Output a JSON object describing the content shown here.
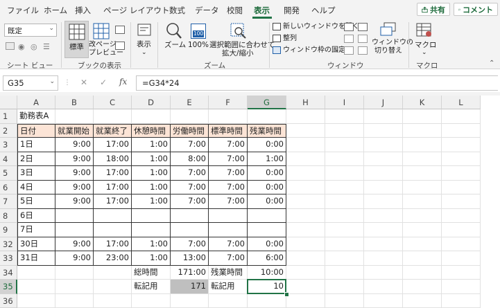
{
  "menu": {
    "tabs": [
      "ファイル",
      "ホーム",
      "挿入",
      "ページ レイアウト",
      "数式",
      "データ",
      "校閲",
      "表示",
      "開発",
      "ヘルプ"
    ],
    "active_tab": "表示",
    "share_label": "共有",
    "comment_label": "コメント"
  },
  "ribbon": {
    "sheet_view": {
      "dropdown_value": "既定",
      "group_label": "シート ビュー"
    },
    "workbook_views": {
      "normal_label": "標準",
      "page_break_label_1": "改ページ",
      "page_break_label_2": "プレビュー",
      "group_label": "ブックの表示"
    },
    "show": {
      "label": "表示"
    },
    "zoom": {
      "zoom_label": "ズーム",
      "hundred_label": "100%",
      "hundred_icon_text": "100",
      "fit_label_1": "選択範囲に合わせて",
      "fit_label_2": "拡大/縮小",
      "group_label": "ズーム"
    },
    "window": {
      "new_window": "新しいウィンドウを開く",
      "arrange": "整列",
      "freeze": "ウィンドウ枠の固定",
      "switch_label_1": "ウィンドウの",
      "switch_label_2": "切り替え",
      "group_label": "ウィンドウ"
    },
    "macro": {
      "label": "マクロ",
      "group_label": "マクロ"
    }
  },
  "formula_bar": {
    "name_box": "G35",
    "fx": "fx",
    "formula": "=G34*24"
  },
  "sheet": {
    "columns": [
      "A",
      "B",
      "C",
      "D",
      "E",
      "F",
      "G",
      "H",
      "I",
      "J",
      "K",
      "L"
    ],
    "selected_column": "G",
    "selected_row": "35",
    "rows": [
      {
        "num": "1",
        "cells": [
          "勤務表A",
          "",
          "",
          "",
          "",
          "",
          ""
        ]
      },
      {
        "num": "2",
        "cells": [
          "日付",
          "就業開始",
          "就業終了",
          "休憩時間",
          "労働時間",
          "標準時間",
          "残業時間"
        ]
      },
      {
        "num": "3",
        "cells": [
          "1日",
          "9:00",
          "17:00",
          "1:00",
          "7:00",
          "7:00",
          "0:00"
        ]
      },
      {
        "num": "4",
        "cells": [
          "2日",
          "9:00",
          "18:00",
          "1:00",
          "8:00",
          "7:00",
          "1:00"
        ]
      },
      {
        "num": "5",
        "cells": [
          "3日",
          "9:00",
          "17:00",
          "1:00",
          "7:00",
          "7:00",
          "0:00"
        ]
      },
      {
        "num": "6",
        "cells": [
          "4日",
          "9:00",
          "17:00",
          "1:00",
          "7:00",
          "7:00",
          "0:00"
        ]
      },
      {
        "num": "7",
        "cells": [
          "5日",
          "9:00",
          "17:00",
          "1:00",
          "7:00",
          "7:00",
          "0:00"
        ]
      },
      {
        "num": "8",
        "cells": [
          "6日",
          "",
          "",
          "",
          "",
          "",
          ""
        ]
      },
      {
        "num": "9",
        "cells": [
          "7日",
          "",
          "",
          "",
          "",
          "",
          ""
        ]
      },
      {
        "num": "32",
        "cells": [
          "30日",
          "9:00",
          "17:00",
          "1:00",
          "7:00",
          "7:00",
          "0:00"
        ]
      },
      {
        "num": "33",
        "cells": [
          "31日",
          "9:00",
          "23:00",
          "1:00",
          "13:00",
          "7:00",
          "6:00"
        ]
      },
      {
        "num": "34",
        "cells": [
          "",
          "",
          "",
          "総時間",
          "171:00",
          "残業時間",
          "10:00"
        ]
      },
      {
        "num": "35",
        "cells": [
          "",
          "",
          "",
          "転記用",
          "171",
          "転記用",
          "10"
        ]
      },
      {
        "num": "36",
        "cells": [
          "",
          "",
          "",
          "",
          "",
          "",
          ""
        ]
      }
    ]
  },
  "colors": {
    "accent": "#217346",
    "header_fill": "#fce4d6",
    "gray_fill": "#bfbfbf"
  }
}
